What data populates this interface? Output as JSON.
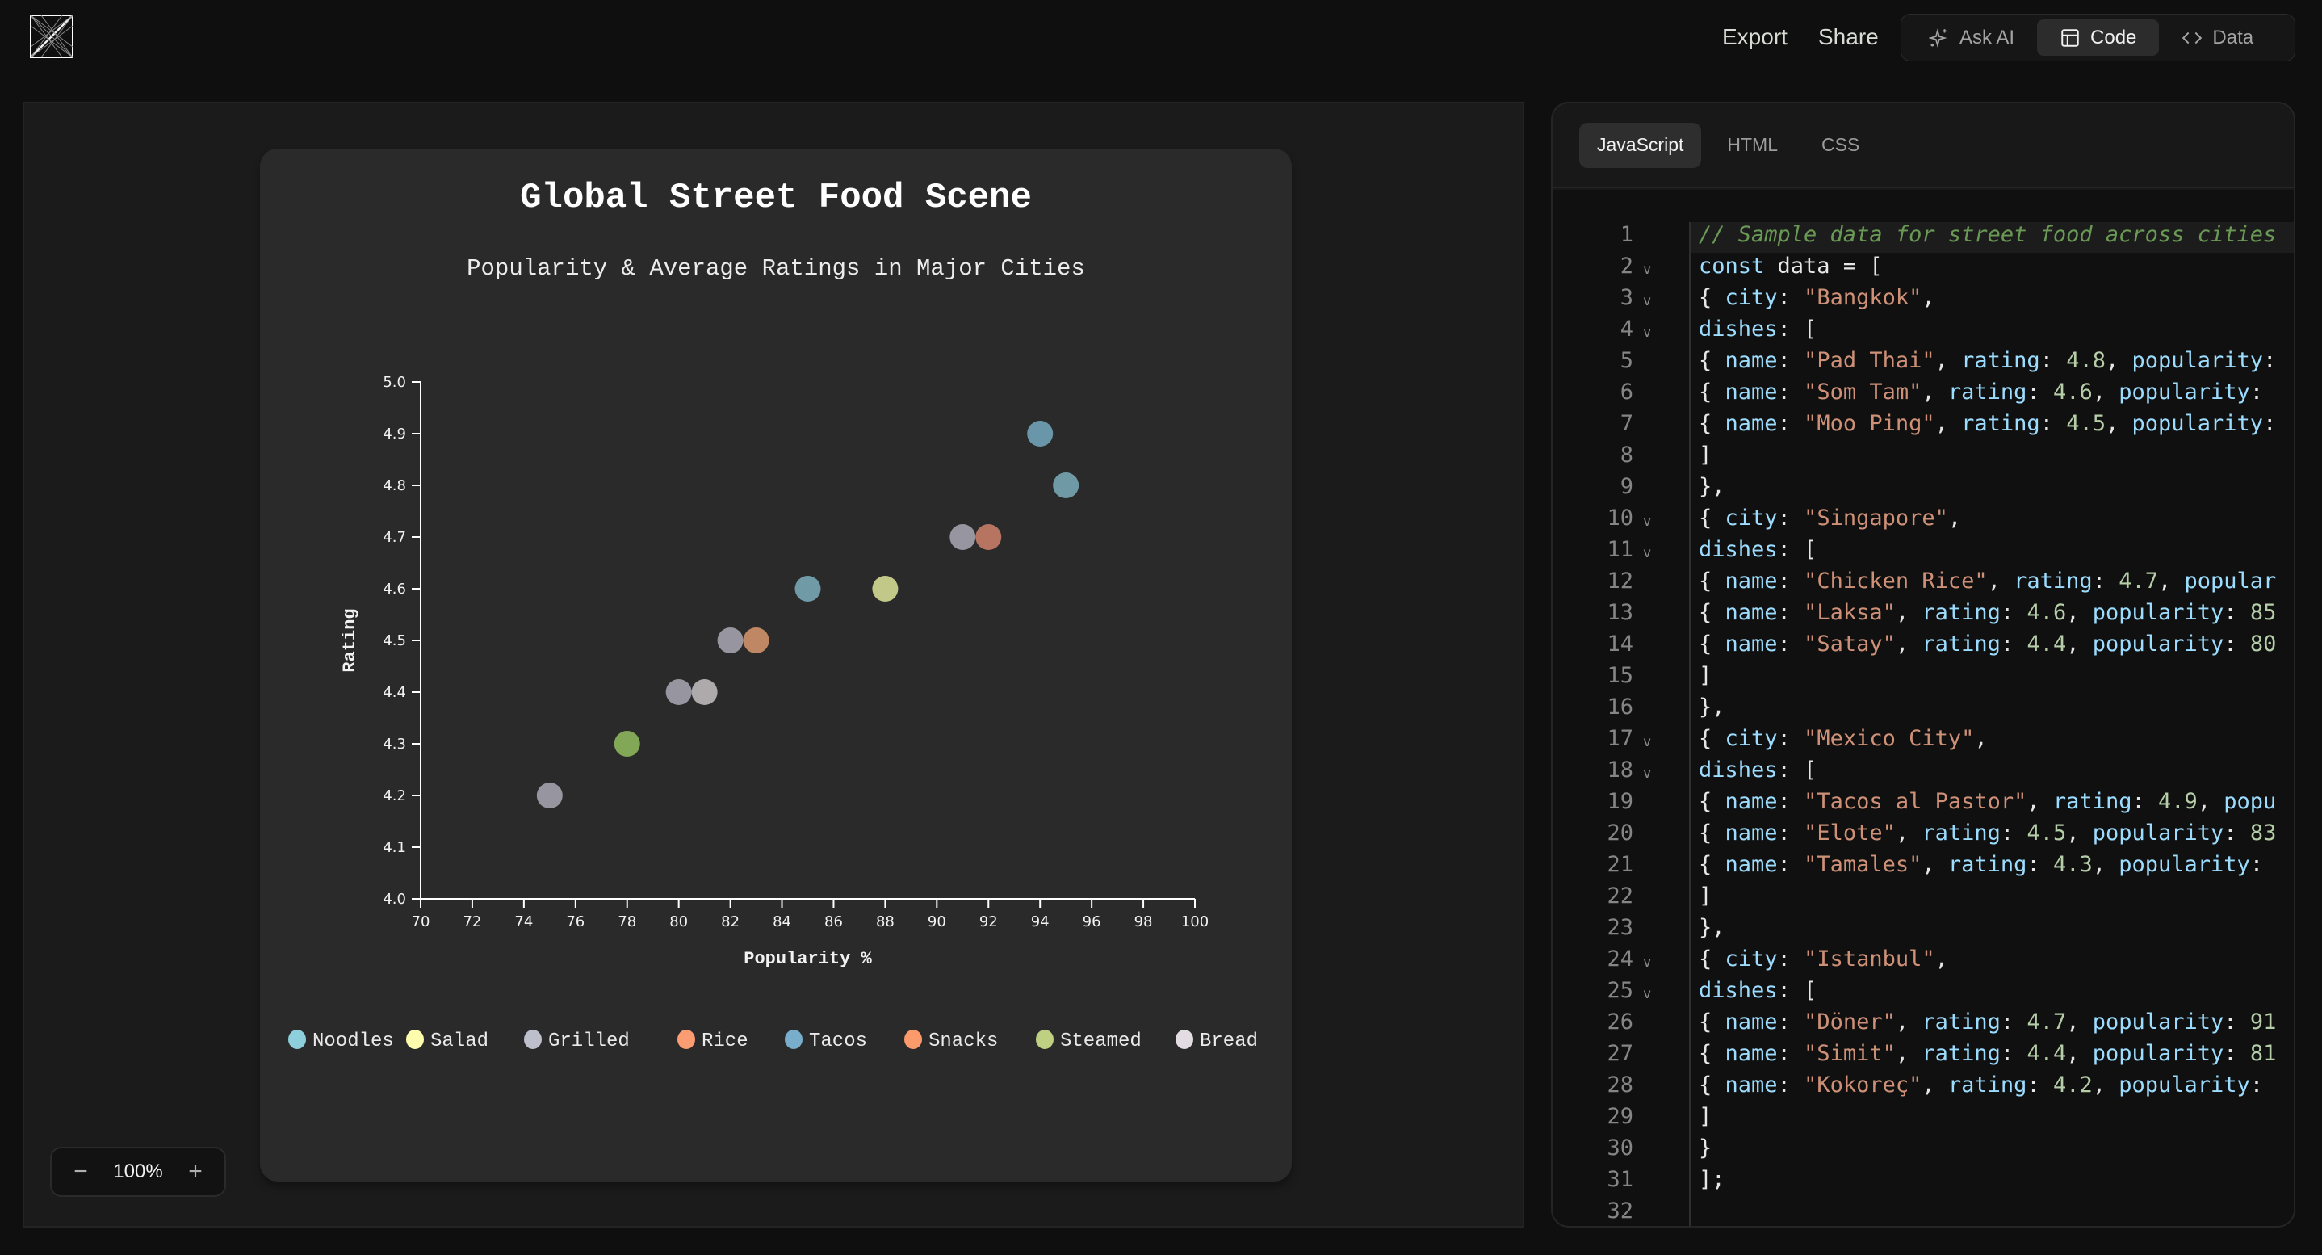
{
  "header": {
    "export_label": "Export",
    "share_label": "Share",
    "tabs": [
      {
        "label": "Ask AI",
        "icon": "sparkle-icon",
        "active": false
      },
      {
        "label": "Code",
        "icon": "layout-icon",
        "active": true
      },
      {
        "label": "Data",
        "icon": "code-brackets-icon",
        "active": false
      }
    ]
  },
  "canvas": {
    "zoom_level": "100%",
    "zoom_out_symbol": "−",
    "zoom_in_symbol": "+"
  },
  "chart_data": {
    "type": "scatter",
    "title": "Global Street Food Scene",
    "subtitle": "Popularity & Average Ratings in Major Cities",
    "xlabel": "Popularity %",
    "ylabel": "Rating",
    "xlim": [
      70,
      100
    ],
    "ylim": [
      4.0,
      5.0
    ],
    "x_ticks": [
      "70",
      "72",
      "74",
      "76",
      "78",
      "80",
      "82",
      "84",
      "86",
      "88",
      "90",
      "92",
      "94",
      "96",
      "98",
      "100"
    ],
    "y_ticks": [
      "4.0",
      "4.1",
      "4.2",
      "4.3",
      "4.4",
      "4.5",
      "4.6",
      "4.7",
      "4.8",
      "4.9",
      "5.0"
    ],
    "grid": false,
    "legend_position": "bottom",
    "legend": [
      {
        "label": "Noodles",
        "color": "#8ecfdc"
      },
      {
        "label": "Salad",
        "color": "#fdfdad"
      },
      {
        "label": "Grilled",
        "color": "#bdbfcb"
      },
      {
        "label": "Rice",
        "color": "#fc9c72"
      },
      {
        "label": "Tacos",
        "color": "#78aecb"
      },
      {
        "label": "Snacks",
        "color": "#fd9a6b"
      },
      {
        "label": "Steamed",
        "color": "#bfd083"
      },
      {
        "label": "Bread",
        "color": "#e3dce0"
      }
    ],
    "points": [
      {
        "name": "Pad Thai",
        "city": "Bangkok",
        "popularity": 95,
        "rating": 4.8,
        "color": "#6f99a4"
      },
      {
        "name": "Som Tam",
        "city": "Bangkok",
        "popularity": 88,
        "rating": 4.6,
        "color": "#c2c888"
      },
      {
        "name": "Moo Ping",
        "city": "Bangkok",
        "popularity": 82,
        "rating": 4.5,
        "color": "#97959f"
      },
      {
        "name": "Chicken Rice",
        "city": "Singapore",
        "popularity": 92,
        "rating": 4.7,
        "color": "#b67461"
      },
      {
        "name": "Laksa",
        "city": "Singapore",
        "popularity": 85,
        "rating": 4.6,
        "color": "#6f9aa6"
      },
      {
        "name": "Satay",
        "city": "Singapore",
        "popularity": 80,
        "rating": 4.4,
        "color": "#97959f"
      },
      {
        "name": "Tacos al Pastor",
        "city": "Mexico City",
        "popularity": 94,
        "rating": 4.9,
        "color": "#6a96a9"
      },
      {
        "name": "Elote",
        "city": "Mexico City",
        "popularity": 83,
        "rating": 4.5,
        "color": "#bf8764"
      },
      {
        "name": "Tamales",
        "city": "Mexico City",
        "popularity": 78,
        "rating": 4.3,
        "color": "#82a857"
      },
      {
        "name": "Döner",
        "city": "Istanbul",
        "popularity": 91,
        "rating": 4.7,
        "color": "#97959f"
      },
      {
        "name": "Simit",
        "city": "Istanbul",
        "popularity": 81,
        "rating": 4.4,
        "color": "#aeaaab"
      },
      {
        "name": "Kokoreç",
        "city": "Istanbul",
        "popularity": 75,
        "rating": 4.2,
        "color": "#97959f"
      }
    ]
  },
  "code_panel": {
    "tabs": [
      {
        "label": "JavaScript",
        "active": true
      },
      {
        "label": "HTML",
        "active": false
      },
      {
        "label": "CSS",
        "active": false
      }
    ],
    "lines": [
      {
        "n": "1",
        "fold": false,
        "tokens": [
          [
            "com",
            "// Sample data for street food across cities"
          ]
        ]
      },
      {
        "n": "2",
        "fold": true,
        "tokens": [
          [
            "kw",
            "const"
          ],
          [
            "var",
            " data "
          ],
          [
            "punc",
            "= ["
          ]
        ]
      },
      {
        "n": "3",
        "fold": true,
        "tokens": [
          [
            "punc",
            "{ "
          ],
          [
            "key",
            "city"
          ],
          [
            "punc",
            ": "
          ],
          [
            "str",
            "\"Bangkok\""
          ],
          [
            "punc",
            ","
          ]
        ]
      },
      {
        "n": "4",
        "fold": true,
        "tokens": [
          [
            "key",
            "dishes"
          ],
          [
            "punc",
            ": ["
          ]
        ]
      },
      {
        "n": "5",
        "fold": false,
        "tokens": [
          [
            "punc",
            "{ "
          ],
          [
            "key",
            "name"
          ],
          [
            "punc",
            ": "
          ],
          [
            "str",
            "\"Pad Thai\""
          ],
          [
            "punc",
            ", "
          ],
          [
            "key",
            "rating"
          ],
          [
            "punc",
            ": "
          ],
          [
            "num",
            "4.8"
          ],
          [
            "punc",
            ", "
          ],
          [
            "key",
            "popularity"
          ],
          [
            "punc",
            ":"
          ]
        ]
      },
      {
        "n": "6",
        "fold": false,
        "tokens": [
          [
            "punc",
            "{ "
          ],
          [
            "key",
            "name"
          ],
          [
            "punc",
            ": "
          ],
          [
            "str",
            "\"Som Tam\""
          ],
          [
            "punc",
            ", "
          ],
          [
            "key",
            "rating"
          ],
          [
            "punc",
            ": "
          ],
          [
            "num",
            "4.6"
          ],
          [
            "punc",
            ", "
          ],
          [
            "key",
            "popularity"
          ],
          [
            "punc",
            ":"
          ]
        ]
      },
      {
        "n": "7",
        "fold": false,
        "tokens": [
          [
            "punc",
            "{ "
          ],
          [
            "key",
            "name"
          ],
          [
            "punc",
            ": "
          ],
          [
            "str",
            "\"Moo Ping\""
          ],
          [
            "punc",
            ", "
          ],
          [
            "key",
            "rating"
          ],
          [
            "punc",
            ": "
          ],
          [
            "num",
            "4.5"
          ],
          [
            "punc",
            ", "
          ],
          [
            "key",
            "popularity"
          ],
          [
            "punc",
            ":"
          ]
        ]
      },
      {
        "n": "8",
        "fold": false,
        "tokens": [
          [
            "punc",
            "]"
          ]
        ]
      },
      {
        "n": "9",
        "fold": false,
        "tokens": [
          [
            "punc",
            "},"
          ]
        ]
      },
      {
        "n": "10",
        "fold": true,
        "tokens": [
          [
            "punc",
            "{ "
          ],
          [
            "key",
            "city"
          ],
          [
            "punc",
            ": "
          ],
          [
            "str",
            "\"Singapore\""
          ],
          [
            "punc",
            ","
          ]
        ]
      },
      {
        "n": "11",
        "fold": true,
        "tokens": [
          [
            "key",
            "dishes"
          ],
          [
            "punc",
            ": ["
          ]
        ]
      },
      {
        "n": "12",
        "fold": false,
        "tokens": [
          [
            "punc",
            "{ "
          ],
          [
            "key",
            "name"
          ],
          [
            "punc",
            ": "
          ],
          [
            "str",
            "\"Chicken Rice\""
          ],
          [
            "punc",
            ", "
          ],
          [
            "key",
            "rating"
          ],
          [
            "punc",
            ": "
          ],
          [
            "num",
            "4.7"
          ],
          [
            "punc",
            ", "
          ],
          [
            "key",
            "popular"
          ]
        ]
      },
      {
        "n": "13",
        "fold": false,
        "tokens": [
          [
            "punc",
            "{ "
          ],
          [
            "key",
            "name"
          ],
          [
            "punc",
            ": "
          ],
          [
            "str",
            "\"Laksa\""
          ],
          [
            "punc",
            ", "
          ],
          [
            "key",
            "rating"
          ],
          [
            "punc",
            ": "
          ],
          [
            "num",
            "4.6"
          ],
          [
            "punc",
            ", "
          ],
          [
            "key",
            "popularity"
          ],
          [
            "punc",
            ": "
          ],
          [
            "num",
            "85"
          ]
        ]
      },
      {
        "n": "14",
        "fold": false,
        "tokens": [
          [
            "punc",
            "{ "
          ],
          [
            "key",
            "name"
          ],
          [
            "punc",
            ": "
          ],
          [
            "str",
            "\"Satay\""
          ],
          [
            "punc",
            ", "
          ],
          [
            "key",
            "rating"
          ],
          [
            "punc",
            ": "
          ],
          [
            "num",
            "4.4"
          ],
          [
            "punc",
            ", "
          ],
          [
            "key",
            "popularity"
          ],
          [
            "punc",
            ": "
          ],
          [
            "num",
            "80"
          ]
        ]
      },
      {
        "n": "15",
        "fold": false,
        "tokens": [
          [
            "punc",
            "]"
          ]
        ]
      },
      {
        "n": "16",
        "fold": false,
        "tokens": [
          [
            "punc",
            "},"
          ]
        ]
      },
      {
        "n": "17",
        "fold": true,
        "tokens": [
          [
            "punc",
            "{ "
          ],
          [
            "key",
            "city"
          ],
          [
            "punc",
            ": "
          ],
          [
            "str",
            "\"Mexico City\""
          ],
          [
            "punc",
            ","
          ]
        ]
      },
      {
        "n": "18",
        "fold": true,
        "tokens": [
          [
            "key",
            "dishes"
          ],
          [
            "punc",
            ": ["
          ]
        ]
      },
      {
        "n": "19",
        "fold": false,
        "tokens": [
          [
            "punc",
            "{ "
          ],
          [
            "key",
            "name"
          ],
          [
            "punc",
            ": "
          ],
          [
            "str",
            "\"Tacos al Pastor\""
          ],
          [
            "punc",
            ", "
          ],
          [
            "key",
            "rating"
          ],
          [
            "punc",
            ": "
          ],
          [
            "num",
            "4.9"
          ],
          [
            "punc",
            ", "
          ],
          [
            "key",
            "popu"
          ]
        ]
      },
      {
        "n": "20",
        "fold": false,
        "tokens": [
          [
            "punc",
            "{ "
          ],
          [
            "key",
            "name"
          ],
          [
            "punc",
            ": "
          ],
          [
            "str",
            "\"Elote\""
          ],
          [
            "punc",
            ", "
          ],
          [
            "key",
            "rating"
          ],
          [
            "punc",
            ": "
          ],
          [
            "num",
            "4.5"
          ],
          [
            "punc",
            ", "
          ],
          [
            "key",
            "popularity"
          ],
          [
            "punc",
            ": "
          ],
          [
            "num",
            "83"
          ]
        ]
      },
      {
        "n": "21",
        "fold": false,
        "tokens": [
          [
            "punc",
            "{ "
          ],
          [
            "key",
            "name"
          ],
          [
            "punc",
            ": "
          ],
          [
            "str",
            "\"Tamales\""
          ],
          [
            "punc",
            ", "
          ],
          [
            "key",
            "rating"
          ],
          [
            "punc",
            ": "
          ],
          [
            "num",
            "4.3"
          ],
          [
            "punc",
            ", "
          ],
          [
            "key",
            "popularity"
          ],
          [
            "punc",
            ":"
          ]
        ]
      },
      {
        "n": "22",
        "fold": false,
        "tokens": [
          [
            "punc",
            "]"
          ]
        ]
      },
      {
        "n": "23",
        "fold": false,
        "tokens": [
          [
            "punc",
            "},"
          ]
        ]
      },
      {
        "n": "24",
        "fold": true,
        "tokens": [
          [
            "punc",
            "{ "
          ],
          [
            "key",
            "city"
          ],
          [
            "punc",
            ": "
          ],
          [
            "str",
            "\"Istanbul\""
          ],
          [
            "punc",
            ","
          ]
        ]
      },
      {
        "n": "25",
        "fold": true,
        "tokens": [
          [
            "key",
            "dishes"
          ],
          [
            "punc",
            ": ["
          ]
        ]
      },
      {
        "n": "26",
        "fold": false,
        "tokens": [
          [
            "punc",
            "{ "
          ],
          [
            "key",
            "name"
          ],
          [
            "punc",
            ": "
          ],
          [
            "str",
            "\"Döner\""
          ],
          [
            "punc",
            ", "
          ],
          [
            "key",
            "rating"
          ],
          [
            "punc",
            ": "
          ],
          [
            "num",
            "4.7"
          ],
          [
            "punc",
            ", "
          ],
          [
            "key",
            "popularity"
          ],
          [
            "punc",
            ": "
          ],
          [
            "num",
            "91"
          ]
        ]
      },
      {
        "n": "27",
        "fold": false,
        "tokens": [
          [
            "punc",
            "{ "
          ],
          [
            "key",
            "name"
          ],
          [
            "punc",
            ": "
          ],
          [
            "str",
            "\"Simit\""
          ],
          [
            "punc",
            ", "
          ],
          [
            "key",
            "rating"
          ],
          [
            "punc",
            ": "
          ],
          [
            "num",
            "4.4"
          ],
          [
            "punc",
            ", "
          ],
          [
            "key",
            "popularity"
          ],
          [
            "punc",
            ": "
          ],
          [
            "num",
            "81"
          ]
        ]
      },
      {
        "n": "28",
        "fold": false,
        "tokens": [
          [
            "punc",
            "{ "
          ],
          [
            "key",
            "name"
          ],
          [
            "punc",
            ": "
          ],
          [
            "str",
            "\"Kokoreç\""
          ],
          [
            "punc",
            ", "
          ],
          [
            "key",
            "rating"
          ],
          [
            "punc",
            ": "
          ],
          [
            "num",
            "4.2"
          ],
          [
            "punc",
            ", "
          ],
          [
            "key",
            "popularity"
          ],
          [
            "punc",
            ":"
          ]
        ]
      },
      {
        "n": "29",
        "fold": false,
        "tokens": [
          [
            "punc",
            "]"
          ]
        ]
      },
      {
        "n": "30",
        "fold": false,
        "tokens": [
          [
            "punc",
            "}"
          ]
        ]
      },
      {
        "n": "31",
        "fold": false,
        "tokens": [
          [
            "punc",
            "];"
          ]
        ]
      },
      {
        "n": "32",
        "fold": false,
        "tokens": []
      }
    ]
  }
}
